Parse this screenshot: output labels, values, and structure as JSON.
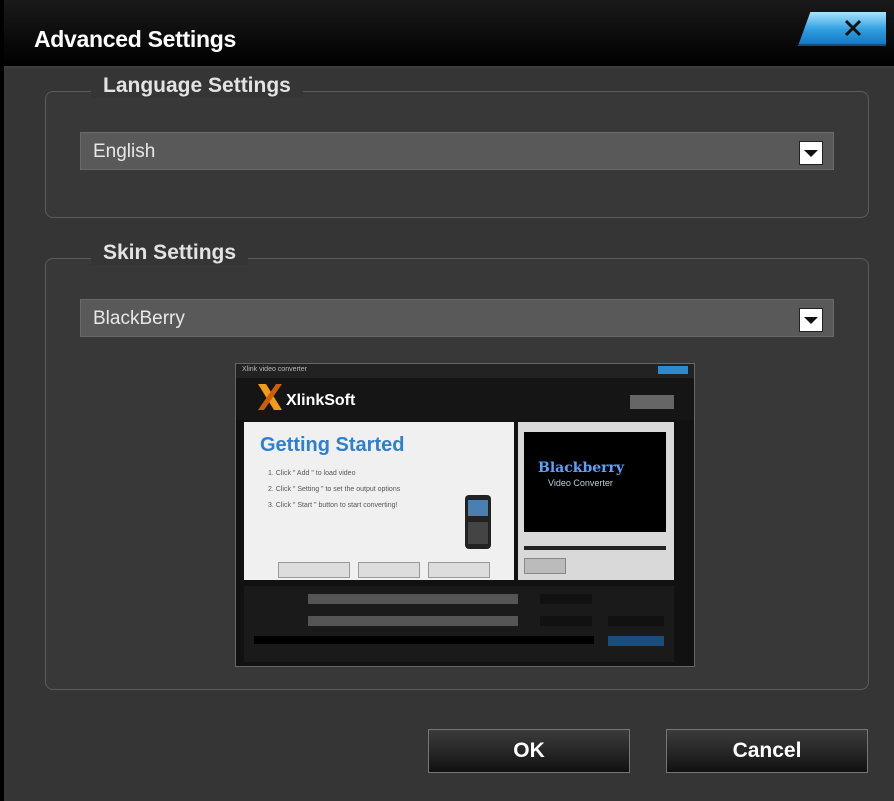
{
  "window": {
    "title": "Advanced Settings"
  },
  "language": {
    "legend": "Language Settings",
    "selected": "English"
  },
  "skin": {
    "legend": "Skin Settings",
    "selected": "BlackBerry",
    "preview": {
      "window_caption": "Xlink video converter",
      "brand": "XlinkSoft",
      "heading": "Getting Started",
      "step1": "1. Click \" Add \" to load video",
      "step2": "2. Click \" Setting \" to set the output options",
      "step3": "3. Click \" Start \" button to start converting!",
      "screen_title": "Blackberry",
      "screen_subtitle": "Video Converter"
    }
  },
  "buttons": {
    "ok": "OK",
    "cancel": "Cancel"
  },
  "colors": {
    "accent": "#2f9fe0",
    "background": "#353535"
  }
}
